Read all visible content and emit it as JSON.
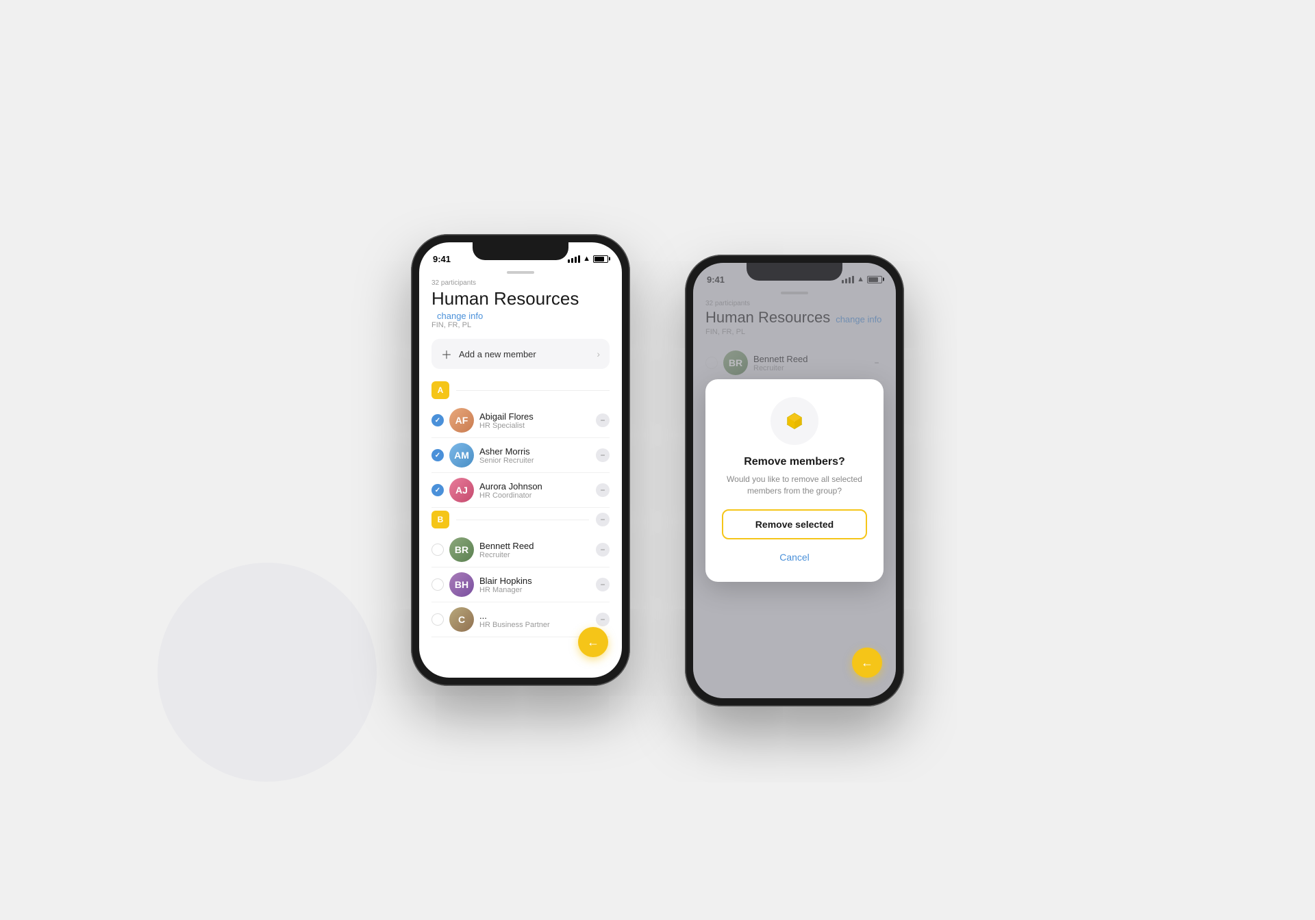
{
  "background_color": "#f0f0f0",
  "phone1": {
    "status_time": "9:41",
    "participants": "32 participants",
    "group_name": "Human Resources",
    "change_info": "change info",
    "languages": "FIN, FR, PL",
    "add_member": "Add a new member",
    "section_a": "A",
    "section_b": "B",
    "members": [
      {
        "name": "Abigail Flores",
        "role": "HR Specialist",
        "checked": true,
        "avatar_class": "avatar-abigail",
        "initials": "AF"
      },
      {
        "name": "Asher Morris",
        "role": "Senior Recruiter",
        "checked": true,
        "avatar_class": "avatar-asher",
        "initials": "AM"
      },
      {
        "name": "Aurora Johnson",
        "role": "HR Coordinator",
        "checked": true,
        "avatar_class": "avatar-aurora",
        "initials": "AJ"
      },
      {
        "name": "Bennett Reed",
        "role": "Recruiter",
        "checked": false,
        "avatar_class": "avatar-bennett",
        "initials": "BR"
      },
      {
        "name": "Blair Hopkins",
        "role": "HR Manager",
        "checked": false,
        "avatar_class": "avatar-blair",
        "initials": "BH"
      },
      {
        "name": "...",
        "role": "HR Business Partner",
        "checked": false,
        "avatar_class": "avatar-c",
        "initials": "C"
      }
    ]
  },
  "phone2": {
    "status_time": "9:41",
    "participants": "32 participants",
    "group_name": "Human Resources",
    "change_info": "change info",
    "languages": "FIN, FR, PL",
    "modal": {
      "title": "Remove members?",
      "description": "Would you like to remove all selected members from the group?",
      "confirm_label": "Remove selected",
      "cancel_label": "Cancel"
    }
  }
}
